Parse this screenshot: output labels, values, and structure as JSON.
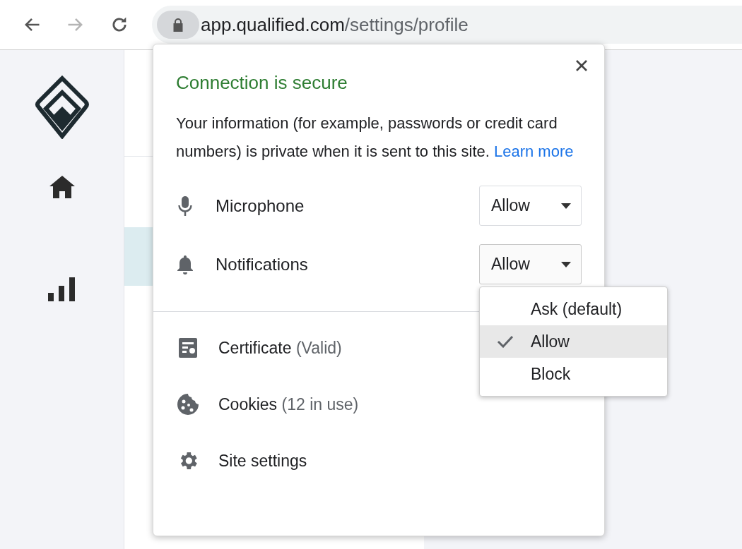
{
  "browser": {
    "nav_buttons": [
      {
        "kind": "back",
        "disabled": false
      },
      {
        "kind": "forward",
        "disabled": true
      },
      {
        "kind": "reload",
        "disabled": false
      }
    ],
    "url": {
      "host": "app.qualified.com",
      "path": "/settings/profile"
    }
  },
  "sidebar": {
    "items": [
      {
        "kind": "home"
      },
      {
        "kind": "chart"
      }
    ]
  },
  "popup": {
    "title": "Connection is secure",
    "description": "Your information (for example, passwords or credit card numbers) is private when it is sent to this site.",
    "link": "Learn more",
    "permissions": [
      {
        "kind": "microphone",
        "label": "Microphone",
        "value": "Allow",
        "expanded": false
      },
      {
        "kind": "notifications",
        "label": "Notifications",
        "value": "Allow",
        "expanded": true,
        "options": [
          {
            "label": "Ask (default)",
            "selected": false
          },
          {
            "label": "Allow",
            "selected": true
          },
          {
            "label": "Block",
            "selected": false
          }
        ]
      }
    ],
    "links": [
      {
        "kind": "certificate",
        "label": "Certificate",
        "detail": "(Valid)"
      },
      {
        "kind": "cookies",
        "label": "Cookies",
        "detail": "(12 in use)"
      },
      {
        "kind": "settings",
        "label": "Site settings"
      }
    ]
  }
}
